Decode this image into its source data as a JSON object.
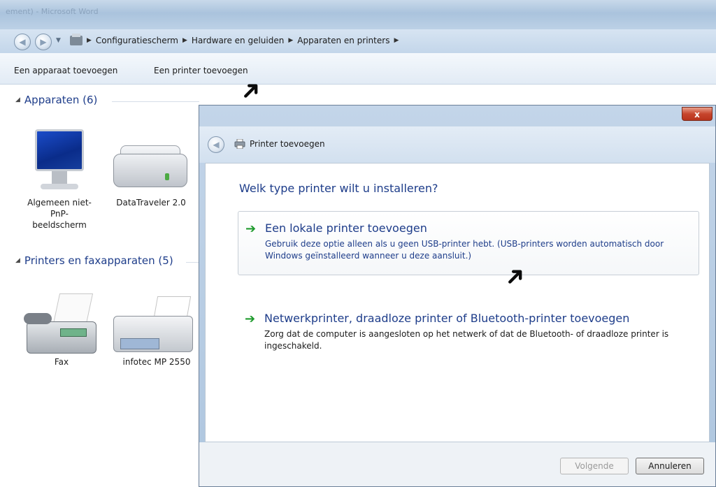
{
  "window": {
    "blurred_title": "ement) - Microsoft Word"
  },
  "breadcrumb": [
    "Configuratiescherm",
    "Hardware en geluiden",
    "Apparaten en printers"
  ],
  "toolbar": {
    "add_device": "Een apparaat toevoegen",
    "add_printer": "Een printer toevoegen"
  },
  "groups": {
    "devices": {
      "title": "Apparaten (6)",
      "items": [
        {
          "label": "Algemeen niet-PnP-beeldscherm",
          "icon": "monitor-icon"
        },
        {
          "label": "DataTraveler 2.0",
          "icon": "usb-drive-icon"
        }
      ]
    },
    "printers": {
      "title": "Printers en faxapparaten (5)",
      "items": [
        {
          "label": "Fax",
          "icon": "fax-icon"
        },
        {
          "label": "infotec MP 2550",
          "icon": "printer-icon"
        }
      ]
    }
  },
  "dialog": {
    "close_label": "x",
    "title": "Printer toevoegen",
    "question": "Welk type printer wilt u installeren?",
    "options": [
      {
        "title": "Een lokale printer toevoegen",
        "description": "Gebruik deze optie alleen als u geen USB-printer hebt. (USB-printers worden automatisch door Windows geïnstalleerd wanneer u deze aansluit.)"
      },
      {
        "title": "Netwerkprinter, draadloze printer of Bluetooth-printer toevoegen",
        "description": "Zorg dat de computer is aangesloten op het netwerk of dat de Bluetooth- of draadloze printer is ingeschakeld."
      }
    ],
    "buttons": {
      "next": "Volgende",
      "cancel": "Annuleren"
    }
  },
  "colors": {
    "link_blue": "#1e3d8a",
    "option_arrow": "#1f9b2d",
    "close_red": "#c7452c"
  }
}
